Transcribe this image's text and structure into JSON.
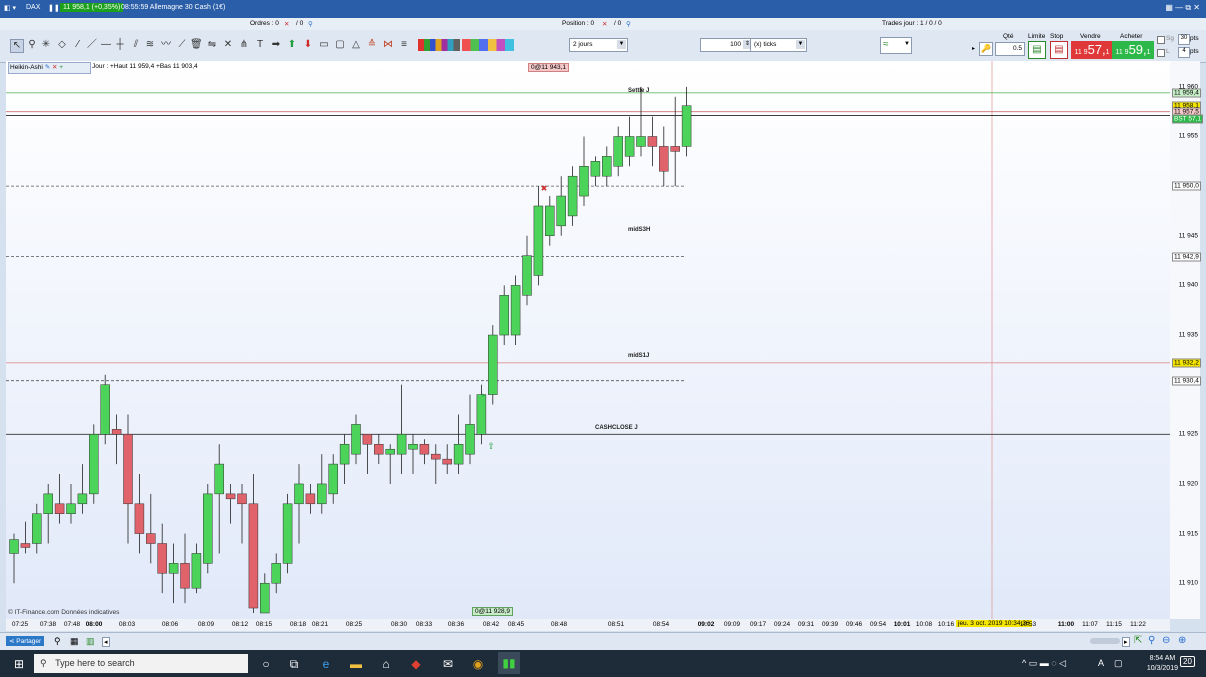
{
  "window": {
    "symbol": "DAX",
    "price_badge": "11 958,1 (+0,35%)",
    "title": "08:55:59 Allemagne 30 Cash (1€)"
  },
  "infobar": {
    "orders": "Ordres : 0",
    "orders_tail": "/ 0",
    "position": "Position : 0",
    "position_tail": "/ 0",
    "trades": "Trades jour : 1 / 0 / 0"
  },
  "toolbar": {
    "period": "2 jours",
    "ticks_value": "100",
    "ticks_unit": "(x) ticks"
  },
  "trade": {
    "qty_label": "Qté",
    "qty_value": "0.5",
    "limit_label": "Limite",
    "stop_label": "Stop",
    "sell_label": "Vendre",
    "buy_label": "Acheter",
    "sell_price_small": "11 9",
    "sell_price_big": "57,",
    "sell_price_tail": "1",
    "buy_price_small": "11 9",
    "buy_price_big": "59,",
    "buy_price_tail": "1",
    "sg_label": "Sg",
    "sg_value": "30",
    "pts_label": "pts",
    "l_label": "L",
    "l_value": "4",
    "l_pts": "pts"
  },
  "indicator": {
    "name": "Heikin-Ashi",
    "jour_info": "Jour : +Haut 11 959,4 +Bas 11 903,4"
  },
  "chart_labels": {
    "top_marker": "0@11 943,1",
    "bottom_marker": "0@11 928,9",
    "settle": "Settle J",
    "mids3h": "midS3H",
    "mids1j": "midS1J",
    "cashclose": "CASHCLOSE J",
    "source": "© IT-Finance.com Données indicatives",
    "date_tag": "jeu. 3 oct. 2019 10:34:36"
  },
  "yaxis": {
    "ticks": [
      "11 960",
      "11 955",
      "11 945",
      "11 940",
      "11 935",
      "11 925",
      "11 920",
      "11 915",
      "11 910"
    ],
    "highlights": [
      "11 959,4",
      "11 958,1",
      "11 957,5",
      "11 950,0",
      "11 942,9",
      "11 932,2",
      "11 930,4"
    ],
    "bst_label": "BST",
    "bst_value": "57,1"
  },
  "xaxis": {
    "ticks": [
      "07:25",
      "07:38",
      "07:48",
      "08:00",
      "08:03",
      "08:06",
      "08:09",
      "08:12",
      "08:15",
      "08:18",
      "08:21",
      "08:25",
      "08:30",
      "08:33",
      "08:36",
      "08:42",
      "08:45",
      "08:48",
      "08:51",
      "08:54",
      "09:02",
      "09:09",
      "09:17",
      "09:24",
      "09:31",
      "09:39",
      "09:46",
      "09:54",
      "10:01",
      "10:08",
      "10:16",
      "10:53",
      "11:00",
      "11:07",
      "11:15",
      "11:22"
    ]
  },
  "chart_data": {
    "type": "candlestick",
    "ylim": [
      11907,
      11962
    ],
    "candles": [
      {
        "o": 11913.0,
        "h": 11915.0,
        "l": 11910.0,
        "c": 11914.4
      },
      {
        "o": 11914.0,
        "h": 11916.2,
        "l": 11913.0,
        "c": 11913.6
      },
      {
        "o": 11914.0,
        "h": 11918.0,
        "l": 11913.0,
        "c": 11917.0
      },
      {
        "o": 11917.0,
        "h": 11920.0,
        "l": 11914.0,
        "c": 11919.0
      },
      {
        "o": 11918.0,
        "h": 11921.0,
        "l": 11916.0,
        "c": 11917.0
      },
      {
        "o": 11917.0,
        "h": 11920.0,
        "l": 11916.0,
        "c": 11918.0
      },
      {
        "o": 11918.0,
        "h": 11922.0,
        "l": 11917.0,
        "c": 11919.0
      },
      {
        "o": 11919.0,
        "h": 11926.0,
        "l": 11918.0,
        "c": 11925.0
      },
      {
        "o": 11925.0,
        "h": 11931.0,
        "l": 11924.0,
        "c": 11930.0
      },
      {
        "o": 11925.5,
        "h": 11927.0,
        "l": 11922.0,
        "c": 11925.0
      },
      {
        "o": 11925.0,
        "h": 11927.0,
        "l": 11914.0,
        "c": 11918.0
      },
      {
        "o": 11918.0,
        "h": 11921.0,
        "l": 11913.0,
        "c": 11915.0
      },
      {
        "o": 11915.0,
        "h": 11919.0,
        "l": 11912.0,
        "c": 11914.0
      },
      {
        "o": 11914.0,
        "h": 11916.0,
        "l": 11909.0,
        "c": 11911.0
      },
      {
        "o": 11911.0,
        "h": 11914.0,
        "l": 11908.0,
        "c": 11912.0
      },
      {
        "o": 11912.0,
        "h": 11915.0,
        "l": 11908.0,
        "c": 11909.5
      },
      {
        "o": 11909.5,
        "h": 11914.0,
        "l": 11909.0,
        "c": 11913.0
      },
      {
        "o": 11912.0,
        "h": 11920.0,
        "l": 11911.0,
        "c": 11919.0
      },
      {
        "o": 11919.0,
        "h": 11924.0,
        "l": 11913.0,
        "c": 11922.0
      },
      {
        "o": 11919.0,
        "h": 11920.0,
        "l": 11916.0,
        "c": 11918.5
      },
      {
        "o": 11919.0,
        "h": 11920.0,
        "l": 11914.0,
        "c": 11918.0
      },
      {
        "o": 11918.0,
        "h": 11921.0,
        "l": 11907.0,
        "c": 11907.5
      },
      {
        "o": 11907.0,
        "h": 11911.0,
        "l": 11907.0,
        "c": 11910.0
      },
      {
        "o": 11910.0,
        "h": 11913.0,
        "l": 11909.0,
        "c": 11912.0
      },
      {
        "o": 11912.0,
        "h": 11919.0,
        "l": 11911.0,
        "c": 11918.0
      },
      {
        "o": 11918.0,
        "h": 11922.0,
        "l": 11914.0,
        "c": 11920.0
      },
      {
        "o": 11919.0,
        "h": 11920.0,
        "l": 11917.0,
        "c": 11918.0
      },
      {
        "o": 11918.0,
        "h": 11923.0,
        "l": 11917.0,
        "c": 11920.0
      },
      {
        "o": 11919.0,
        "h": 11923.0,
        "l": 11918.0,
        "c": 11922.0
      },
      {
        "o": 11922.0,
        "h": 11925.0,
        "l": 11920.0,
        "c": 11924.0
      },
      {
        "o": 11923.0,
        "h": 11927.0,
        "l": 11922.0,
        "c": 11926.0
      },
      {
        "o": 11925.0,
        "h": 11925.0,
        "l": 11921.0,
        "c": 11924.0
      },
      {
        "o": 11924.0,
        "h": 11925.0,
        "l": 11922.0,
        "c": 11923.0
      },
      {
        "o": 11923.0,
        "h": 11924.0,
        "l": 11920.0,
        "c": 11923.5
      },
      {
        "o": 11923.0,
        "h": 11930.0,
        "l": 11921.0,
        "c": 11925.0
      },
      {
        "o": 11923.5,
        "h": 11925.0,
        "l": 11921.0,
        "c": 11924.0
      },
      {
        "o": 11924.0,
        "h": 11924.5,
        "l": 11922.0,
        "c": 11923.0
      },
      {
        "o": 11923.0,
        "h": 11924.0,
        "l": 11920.0,
        "c": 11922.5
      },
      {
        "o": 11922.5,
        "h": 11924.0,
        "l": 11921.0,
        "c": 11922.0
      },
      {
        "o": 11922.0,
        "h": 11927.0,
        "l": 11921.0,
        "c": 11924.0
      },
      {
        "o": 11923.0,
        "h": 11929.0,
        "l": 11922.0,
        "c": 11926.0
      },
      {
        "o": 11925.0,
        "h": 11930.0,
        "l": 11924.0,
        "c": 11929.0
      },
      {
        "o": 11929.0,
        "h": 11936.0,
        "l": 11928.0,
        "c": 11935.0
      },
      {
        "o": 11935.0,
        "h": 11940.0,
        "l": 11934.0,
        "c": 11939.0
      },
      {
        "o": 11935.0,
        "h": 11941.0,
        "l": 11934.0,
        "c": 11940.0
      },
      {
        "o": 11939.0,
        "h": 11945.0,
        "l": 11938.0,
        "c": 11943.0
      },
      {
        "o": 11941.0,
        "h": 11950.0,
        "l": 11940.0,
        "c": 11948.0
      },
      {
        "o": 11945.0,
        "h": 11949.0,
        "l": 11944.0,
        "c": 11948.0
      },
      {
        "o": 11946.0,
        "h": 11951.0,
        "l": 11945.0,
        "c": 11949.0
      },
      {
        "o": 11947.0,
        "h": 11952.0,
        "l": 11946.0,
        "c": 11951.0
      },
      {
        "o": 11949.0,
        "h": 11955.0,
        "l": 11948.0,
        "c": 11952.0
      },
      {
        "o": 11951.0,
        "h": 11953.0,
        "l": 11950.0,
        "c": 11952.5
      },
      {
        "o": 11951.0,
        "h": 11954.0,
        "l": 11950.0,
        "c": 11953.0
      },
      {
        "o": 11952.0,
        "h": 11956.0,
        "l": 11951.0,
        "c": 11955.0
      },
      {
        "o": 11953.0,
        "h": 11957.0,
        "l": 11952.0,
        "c": 11955.0
      },
      {
        "o": 11954.0,
        "h": 11960.0,
        "l": 11953.0,
        "c": 11955.0
      },
      {
        "o": 11955.0,
        "h": 11957.0,
        "l": 11952.0,
        "c": 11954.0
      },
      {
        "o": 11954.0,
        "h": 11956.0,
        "l": 11950.0,
        "c": 11951.5
      },
      {
        "o": 11954.0,
        "h": 11959.0,
        "l": 11950.0,
        "c": 11953.5
      },
      {
        "o": 11954.0,
        "h": 11960.0,
        "l": 11953.0,
        "c": 11958.1
      }
    ],
    "levels": [
      {
        "name": "Settle J",
        "value": 11957.5,
        "color": "#d07070"
      },
      {
        "name": "",
        "value": 11959.4,
        "color": "#66bb66"
      },
      {
        "name": "",
        "value": 11957.1,
        "color": "#000000"
      },
      {
        "name": "",
        "value": 11950.0,
        "color": "#555555",
        "dashed": true
      },
      {
        "name": "midS3H",
        "value": 11942.9,
        "color": "#555555",
        "dashed": true
      },
      {
        "name": "midS1J",
        "value": 11932.2,
        "color": "#e09090"
      },
      {
        "name": "",
        "value": 11930.4,
        "color": "#555555",
        "dashed": true
      },
      {
        "name": "CASHCLOSE J",
        "value": 11925.0,
        "color": "#333333"
      }
    ],
    "up_color": "#4cd35a",
    "down_color": "#e0626a"
  },
  "bottombar": {
    "share": "Partager"
  },
  "taskbar": {
    "search_placeholder": "Type here to search",
    "time": "8:54 AM",
    "date": "10/3/2019",
    "lang": "A",
    "notif": "20"
  }
}
